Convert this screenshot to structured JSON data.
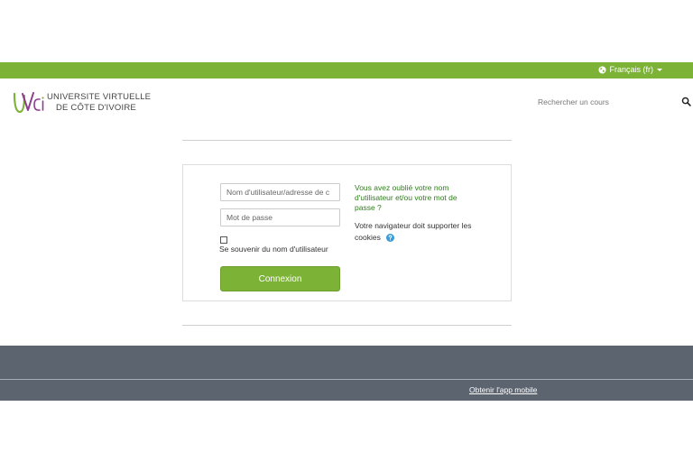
{
  "topbar": {
    "language": "Français (fr)",
    "globe_icon": "globe-icon",
    "accent_color": "#7cb336"
  },
  "header": {
    "logo_mark_text": "UVCI",
    "logo_line1": "UNIVERSITE VIRTUELLE",
    "logo_line2": "DE CÔTE D'IVOIRE",
    "search_placeholder": "Rechercher un cours",
    "search_icon": "search-icon"
  },
  "login": {
    "username_placeholder": "Nom d'utilisateur/adresse de c",
    "username_value": "",
    "password_placeholder": "Mot de passe",
    "password_value": "",
    "remember_label": "Se souvenir du nom d'utilisateur",
    "remember_checked": false,
    "submit_label": "Connexion",
    "forgot_link": "Vous avez oublié votre nom d'utilisateur et/ou votre mot de passe ?",
    "cookies_text": "Votre navigateur doit supporter les cookies",
    "help_icon": "help-icon"
  },
  "footer": {
    "mobile_app_link": "Obtenir l'app mobile",
    "background_color": "#5c6470"
  }
}
